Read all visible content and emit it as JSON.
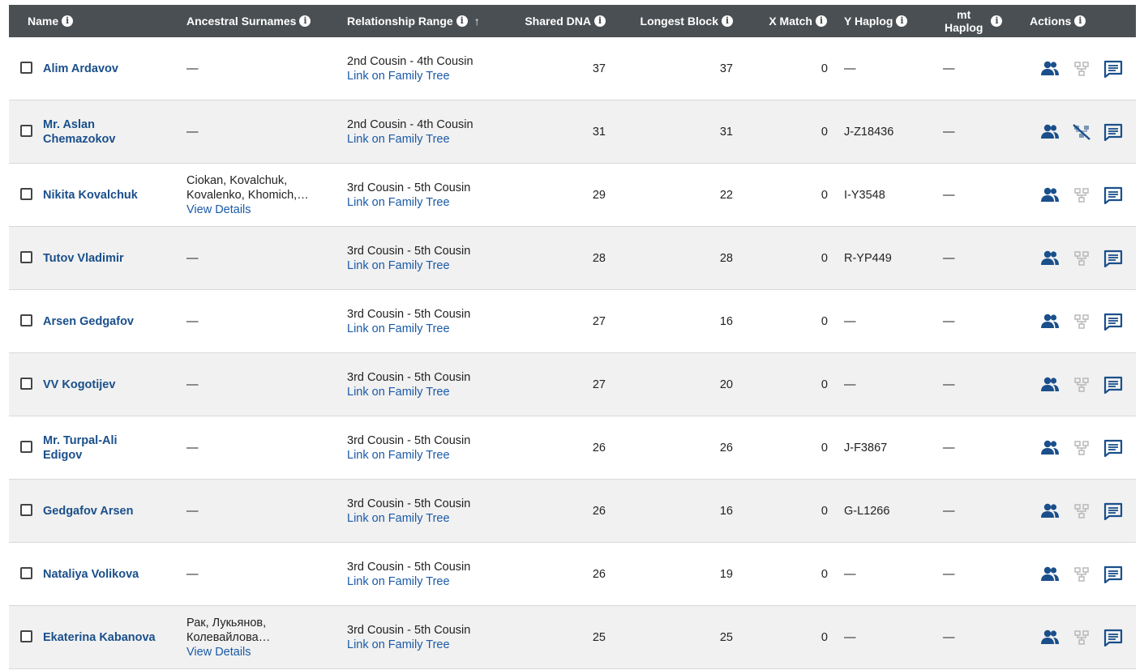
{
  "header": {
    "name": "Name",
    "surnames": "Ancestral Surnames",
    "relationship": "Relationship Range",
    "shared_dna": "Shared DNA",
    "longest_block": "Longest Block",
    "x_match": "X Match",
    "y_haplog": "Y Haplog",
    "mt_haplog_line1": "mt",
    "mt_haplog_line2": "Haplog",
    "actions": "Actions",
    "info_glyph": "i",
    "sort_arrow": "↑"
  },
  "colors": {
    "header_bg": "#4a4f53",
    "name_link": "#1a4f8b",
    "link": "#1a5aa8",
    "icon_blue": "#1a4f8b",
    "icon_gray": "#b8b8b8",
    "row_alt": "#f1f1f1"
  },
  "rows": [
    {
      "name_line1": "Alim Ardavov",
      "name_line2": "",
      "surnames_line1": "—",
      "surnames_line2": "",
      "surnames_link": "",
      "relationship": "2nd Cousin - 4th Cousin",
      "tree_link": "Link on Family Tree",
      "shared_dna": "37",
      "longest_block": "37",
      "x_match": "0",
      "y_haplog": "—",
      "mt_haplog": "—",
      "tree_icon_state": "available"
    },
    {
      "name_line1": "Mr. Aslan",
      "name_line2": "Chemazokov",
      "surnames_line1": "—",
      "surnames_line2": "",
      "surnames_link": "",
      "relationship": "2nd Cousin - 4th Cousin",
      "tree_link": "Link on Family Tree",
      "shared_dna": "31",
      "longest_block": "31",
      "x_match": "0",
      "y_haplog": "J-Z18436",
      "mt_haplog": "—",
      "tree_icon_state": "unavailable"
    },
    {
      "name_line1": "Nikita Kovalchuk",
      "name_line2": "",
      "surnames_line1": "Ciokan, Kovalchuk,",
      "surnames_line2": "Kovalenko, Khomich,…",
      "surnames_link": "View Details",
      "relationship": "3rd Cousin - 5th Cousin",
      "tree_link": "Link on Family Tree",
      "shared_dna": "29",
      "longest_block": "22",
      "x_match": "0",
      "y_haplog": "I-Y3548",
      "mt_haplog": "—",
      "tree_icon_state": "available"
    },
    {
      "name_line1": "Tutov Vladimir",
      "name_line2": "",
      "surnames_line1": "—",
      "surnames_line2": "",
      "surnames_link": "",
      "relationship": "3rd Cousin - 5th Cousin",
      "tree_link": "Link on Family Tree",
      "shared_dna": "28",
      "longest_block": "28",
      "x_match": "0",
      "y_haplog": "R-YP449",
      "mt_haplog": "—",
      "tree_icon_state": "available"
    },
    {
      "name_line1": "Arsen Gedgafov",
      "name_line2": "",
      "surnames_line1": "—",
      "surnames_line2": "",
      "surnames_link": "",
      "relationship": "3rd Cousin - 5th Cousin",
      "tree_link": "Link on Family Tree",
      "shared_dna": "27",
      "longest_block": "16",
      "x_match": "0",
      "y_haplog": "—",
      "mt_haplog": "—",
      "tree_icon_state": "available"
    },
    {
      "name_line1": "VV Kogotijev",
      "name_line2": "",
      "surnames_line1": "—",
      "surnames_line2": "",
      "surnames_link": "",
      "relationship": "3rd Cousin - 5th Cousin",
      "tree_link": "Link on Family Tree",
      "shared_dna": "27",
      "longest_block": "20",
      "x_match": "0",
      "y_haplog": "—",
      "mt_haplog": "—",
      "tree_icon_state": "available"
    },
    {
      "name_line1": "Mr. Turpal-Ali",
      "name_line2": "Edigov",
      "surnames_line1": "—",
      "surnames_line2": "",
      "surnames_link": "",
      "relationship": "3rd Cousin - 5th Cousin",
      "tree_link": "Link on Family Tree",
      "shared_dna": "26",
      "longest_block": "26",
      "x_match": "0",
      "y_haplog": "J-F3867",
      "mt_haplog": "—",
      "tree_icon_state": "available"
    },
    {
      "name_line1": "Gedgafov Arsen",
      "name_line2": "",
      "surnames_line1": "—",
      "surnames_line2": "",
      "surnames_link": "",
      "relationship": "3rd Cousin - 5th Cousin",
      "tree_link": "Link on Family Tree",
      "shared_dna": "26",
      "longest_block": "16",
      "x_match": "0",
      "y_haplog": "G-L1266",
      "mt_haplog": "—",
      "tree_icon_state": "available"
    },
    {
      "name_line1": "Nataliya Volikova",
      "name_line2": "",
      "surnames_line1": "—",
      "surnames_line2": "",
      "surnames_link": "",
      "relationship": "3rd Cousin - 5th Cousin",
      "tree_link": "Link on Family Tree",
      "shared_dna": "26",
      "longest_block": "19",
      "x_match": "0",
      "y_haplog": "—",
      "mt_haplog": "—",
      "tree_icon_state": "available"
    },
    {
      "name_line1": "Ekaterina Kabanova",
      "name_line2": "",
      "surnames_line1": "Рак, Лукьянов,",
      "surnames_line2": "Колевайлова…",
      "surnames_link": "View Details",
      "relationship": "3rd Cousin - 5th Cousin",
      "tree_link": "Link on Family Tree",
      "shared_dna": "25",
      "longest_block": "25",
      "x_match": "0",
      "y_haplog": "—",
      "mt_haplog": "—",
      "tree_icon_state": "available"
    }
  ]
}
